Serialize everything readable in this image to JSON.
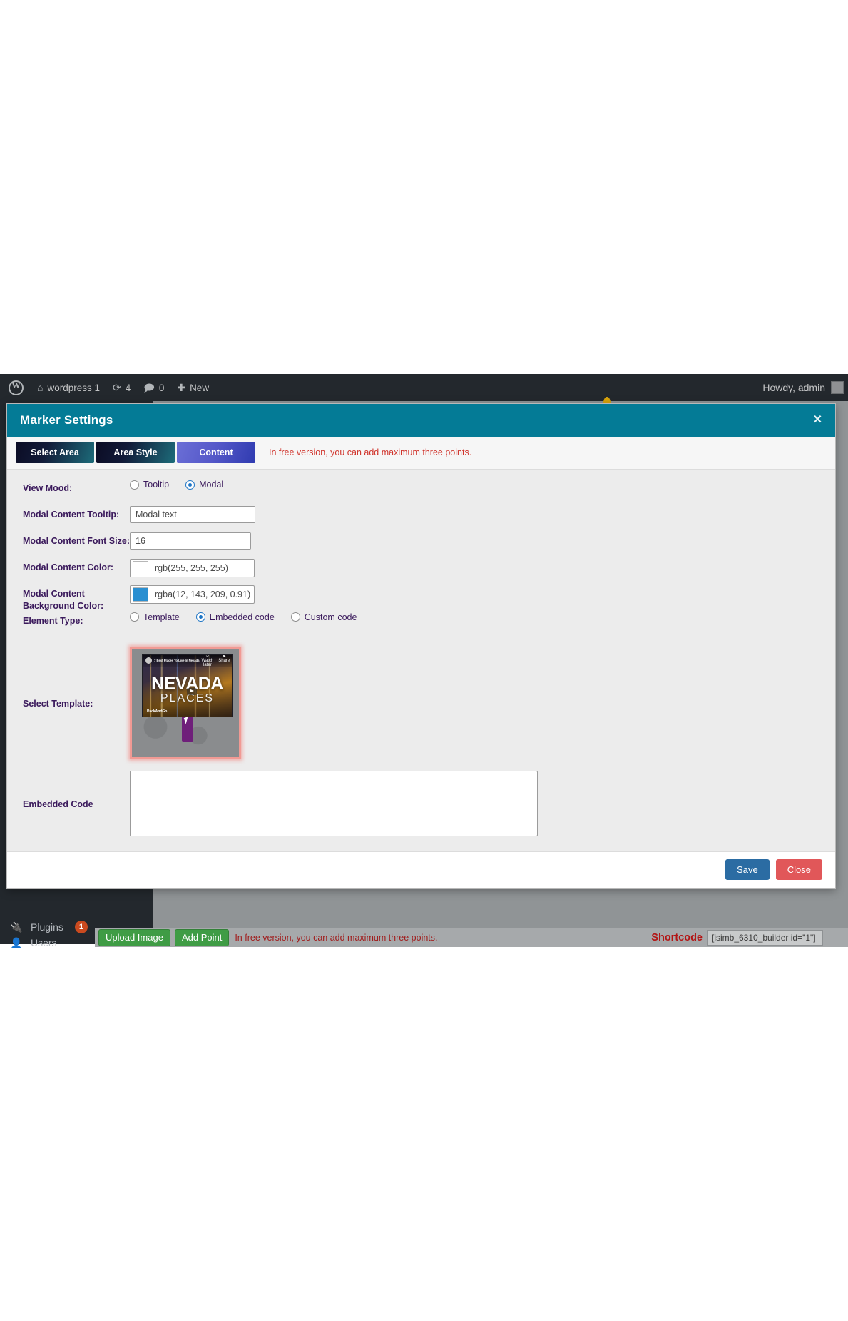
{
  "adminbar": {
    "logo_icon": "wordpress-logo-icon",
    "site_icon": "home-icon",
    "site_name": "wordpress 1",
    "updates_icon": "updates-icon",
    "updates_count": "4",
    "comments_icon": "comment-icon",
    "comments_count": "0",
    "new_icon": "plus-icon",
    "new_label": "New",
    "howdy": "Howdy, admin",
    "avatar": "avatar"
  },
  "sidebar": {
    "items": [
      {
        "label": "Plugins",
        "icon": "plug-icon",
        "badge": "1"
      },
      {
        "label": "Users",
        "icon": "user-icon",
        "badge": ""
      }
    ]
  },
  "modal": {
    "title": "Marker Settings",
    "close_icon": "close-icon",
    "tabs": [
      {
        "label": "Select Area",
        "active": false
      },
      {
        "label": "Area Style",
        "active": false
      },
      {
        "label": "Content",
        "active": true
      }
    ],
    "note": "In free version, you can add maximum three points.",
    "fields": {
      "view_mood": {
        "label": "View Mood:",
        "options": [
          {
            "label": "Tooltip",
            "checked": false
          },
          {
            "label": "Modal",
            "checked": true
          }
        ]
      },
      "modal_content_tooltip": {
        "label": "Modal Content Tooltip:",
        "value": "Modal text"
      },
      "modal_content_font_size": {
        "label": "Modal Content Font Size:",
        "value": "16"
      },
      "modal_content_color": {
        "label": "Modal Content Color:",
        "value": "rgb(255, 255, 255)",
        "swatch": "#ffffff"
      },
      "modal_content_background_color": {
        "label": "Modal Content Background Color:",
        "value": "rgba(12, 143, 209, 0.91)",
        "swatch": "#2a8fd1"
      },
      "element_type": {
        "label": "Element Type:",
        "options": [
          {
            "label": "Template",
            "checked": false
          },
          {
            "label": "Embedded code",
            "checked": true
          },
          {
            "label": "Custom code",
            "checked": false
          }
        ]
      },
      "select_template": {
        "label": "Select Template:",
        "thumbnail": {
          "video_title": "7 Best Places To Live In Nevada",
          "headline": "NEVADA",
          "subhead": "PLACES",
          "brand": "PackAndGo",
          "action_1": "Watch later",
          "action_2": "Share",
          "play_icon": "play-icon",
          "cursor_icon": "cursor-icon"
        }
      },
      "embedded_code": {
        "label": "Embedded Code",
        "value": "",
        "placeholder": ""
      }
    },
    "footer": {
      "save_label": "Save",
      "close_label": "Close"
    }
  },
  "plugin_bar": {
    "upload_image_label": "Upload Image",
    "add_point_label": "Add Point",
    "note": "In free version, you can add maximum three points.",
    "shortcode_label": "Shortcode",
    "shortcode_value": "[isimb_6310_builder id=\"1\"]"
  },
  "colors": {
    "modal_header": "#047b96",
    "accent_tab_active": "#5558c9",
    "warning_red": "#d0342c",
    "save_blue": "#2b6ca3",
    "close_red": "#e15759",
    "green_button": "#3f9c45"
  }
}
